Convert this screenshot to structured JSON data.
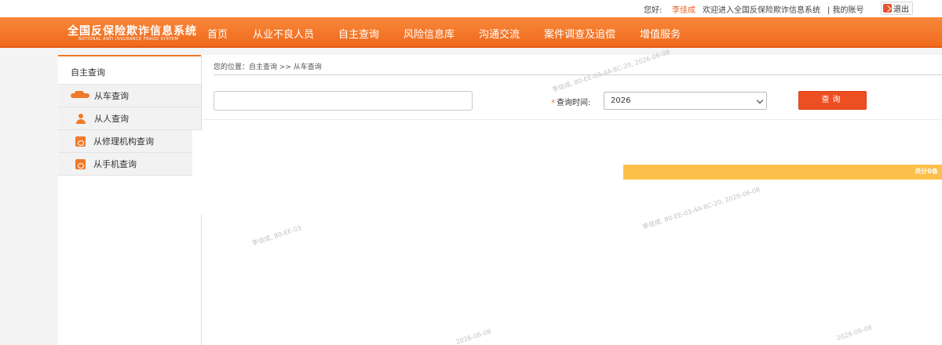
{
  "topbar": {
    "greeting": "您好:",
    "user_name": "李佳成",
    "welcome": "欢迎进入全国反保险欺诈信息系统",
    "account": "| 我的账号",
    "logout": "退出"
  },
  "brand": {
    "name_cn": "全国反保险欺诈信息系统",
    "name_en": "NATIONAL ANTI INSURANCE FRAUD SYSTEM"
  },
  "nav": {
    "items": [
      "首页",
      "从业不良人员",
      "自主查询",
      "风险信息库",
      "沟通交流",
      "案件调查及追偿",
      "增值服务"
    ]
  },
  "sidebar": {
    "header": "自主查询",
    "items": [
      {
        "label": "从车查询",
        "icon": "car-icon"
      },
      {
        "label": "从人查询",
        "icon": "person-icon"
      },
      {
        "label": "从修理机构查询",
        "icon": "document-icon"
      },
      {
        "label": "从手机查询",
        "icon": "document-icon"
      }
    ]
  },
  "main": {
    "breadcrumb": "您的位置：自主查询 >> 从车查询",
    "search_value": "",
    "time_label": "查询时间:",
    "time_required_mark": "*",
    "year_value": "2026",
    "query_button": "查询",
    "result_count": "共计0条"
  },
  "watermarks": [
    "李佳成, 80-EE-03-4A-8C-20, 2026-06-08",
    "2026-06-08",
    "李佳成, 80-EE-03",
    "2026-06-08"
  ],
  "colors": {
    "accent": "#f07a2a",
    "button": "#ee4f22",
    "result_bar": "#fbbf4a"
  }
}
